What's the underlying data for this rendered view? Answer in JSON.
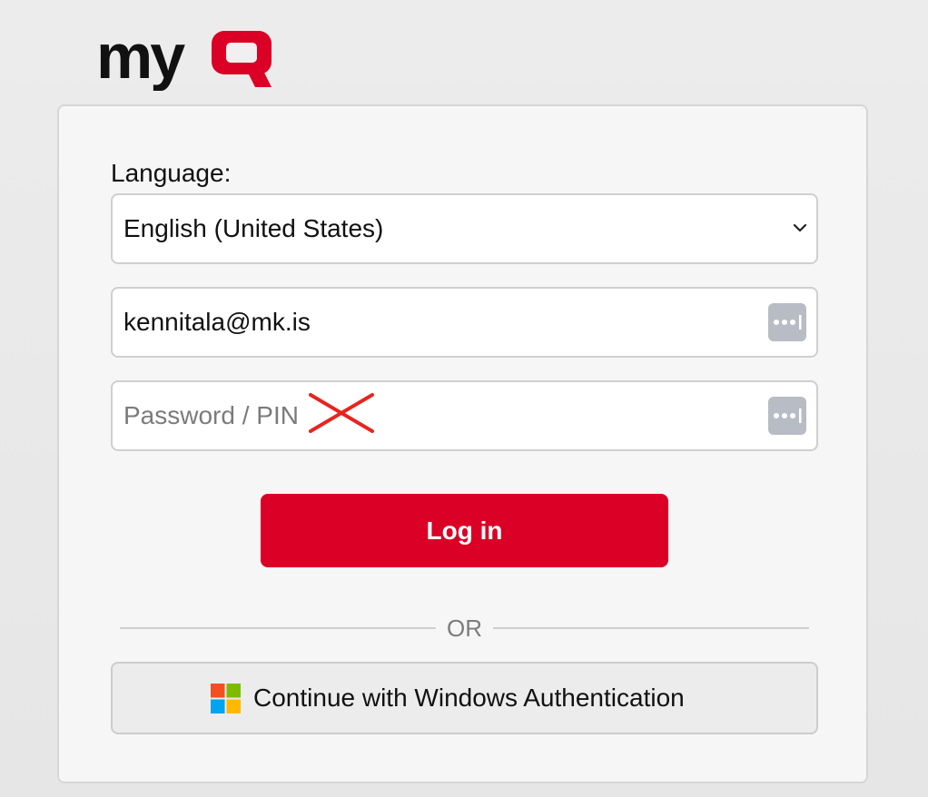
{
  "brand": {
    "logo_text": "myQ",
    "logo_colors": {
      "my": "#111111",
      "q": "#db0025"
    }
  },
  "form": {
    "language_label": "Language:",
    "language_selected": "English (United States)",
    "username_value": "kennitala@mk.is",
    "password_placeholder": "Password / PIN",
    "login_label": "Log in",
    "or_label": "OR",
    "windows_auth_label": "Continue with Windows Authentication"
  },
  "icons": {
    "dropdown": "chevron-down-icon",
    "password_manager": "keychain-icon",
    "cross_out": "red-x-annotation",
    "windows": "windows-logo-icon"
  },
  "colors": {
    "accent": "#db0025",
    "annotation": "#e8241f"
  }
}
